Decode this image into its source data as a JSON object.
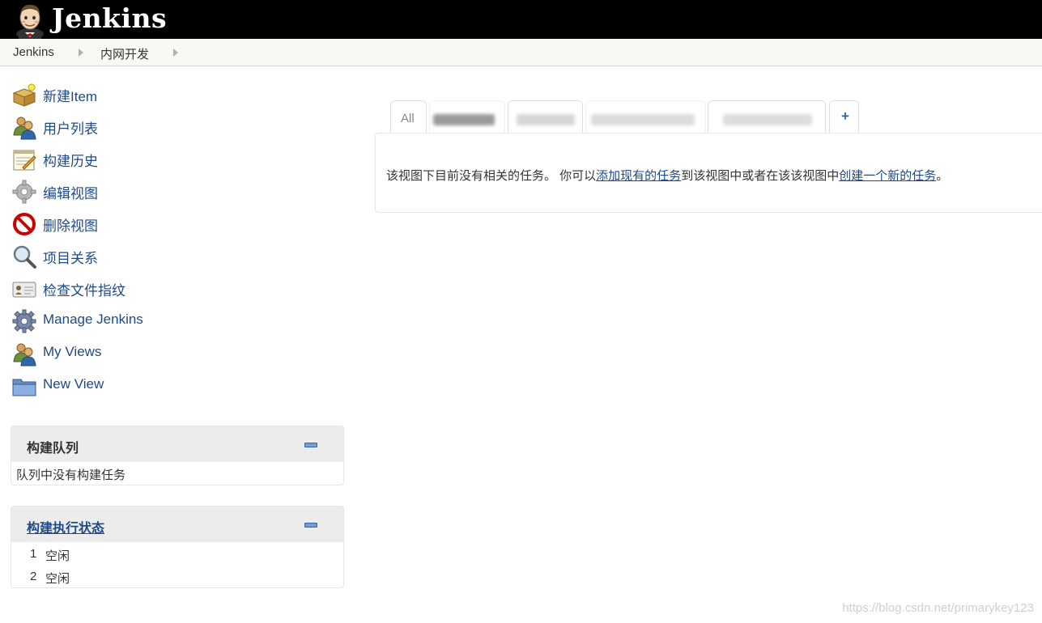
{
  "header": {
    "brand": "Jenkins",
    "logo_icon": "jenkins-butler-logo"
  },
  "breadcrumb": [
    {
      "label": "Jenkins"
    },
    {
      "label": "内网开发"
    }
  ],
  "tasks": [
    {
      "label": "新建Item",
      "icon": "new-item-icon"
    },
    {
      "label": "用户列表",
      "icon": "users-icon"
    },
    {
      "label": "构建历史",
      "icon": "notepad-icon"
    },
    {
      "label": "编辑视图",
      "icon": "gear-icon"
    },
    {
      "label": "删除视图",
      "icon": "no-entry-icon"
    },
    {
      "label": "项目关系",
      "icon": "magnifier-icon"
    },
    {
      "label": "检查文件指纹",
      "icon": "fingerprint-card-icon"
    },
    {
      "label": "Manage Jenkins",
      "icon": "gear-icon"
    },
    {
      "label": "My Views",
      "icon": "users-icon"
    },
    {
      "label": "New View",
      "icon": "folder-icon"
    }
  ],
  "build_queue": {
    "title": "构建队列",
    "empty_text": "队列中没有构建任务"
  },
  "executors": {
    "title": "构建执行状态",
    "rows": [
      {
        "num": "1",
        "status": "空闲"
      },
      {
        "num": "2",
        "status": "空闲"
      }
    ]
  },
  "view_tabs": {
    "active": "All",
    "add": "+"
  },
  "view_message": {
    "prefix": "该视图下目前没有相关的任务。 你可以",
    "link1": "添加现有的任务",
    "middle": "到该视图中或者在该该视图中",
    "link2": "创建一个新的任务",
    "suffix": "。"
  },
  "watermark": "https://blog.csdn.net/primarykey123",
  "colors": {
    "header_bg": "#000000",
    "link": "#204a87",
    "breadcrumb_bg": "#f6faf2"
  }
}
